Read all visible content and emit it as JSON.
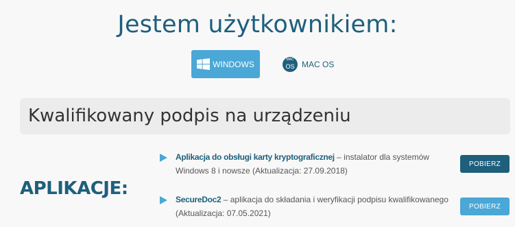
{
  "heading": "Jestem użytkownikiem:",
  "os_tabs": [
    {
      "label": "WINDOWS",
      "icon": "windows-icon",
      "active": true
    },
    {
      "label": "MAC OS",
      "icon": "mac-os-icon",
      "icon_text": "mac",
      "icon_main": "OS",
      "active": false
    }
  ],
  "section_title": "Kwalifikowany podpis na urządzeniu",
  "apps_label": "APLIKACJE:",
  "apps": [
    {
      "name": "Aplikacja do obsługi karty kryptograficznej",
      "description": " – instalator dla systemów Windows 8 i nowsze (Aktualizacja: 27.09.2018)",
      "button": "POBIERZ"
    },
    {
      "name": "SecureDoc2",
      "description": " – aplikacja do składania i weryfikacji podpisu kwalifikowanego (Aktualizacja: 07.05.2021)",
      "button": "POBIERZ"
    }
  ],
  "colors": {
    "primary": "#1e5f7c",
    "accent": "#4aa7d6",
    "background": "#f8f8f8",
    "section_bg": "#ececec"
  }
}
